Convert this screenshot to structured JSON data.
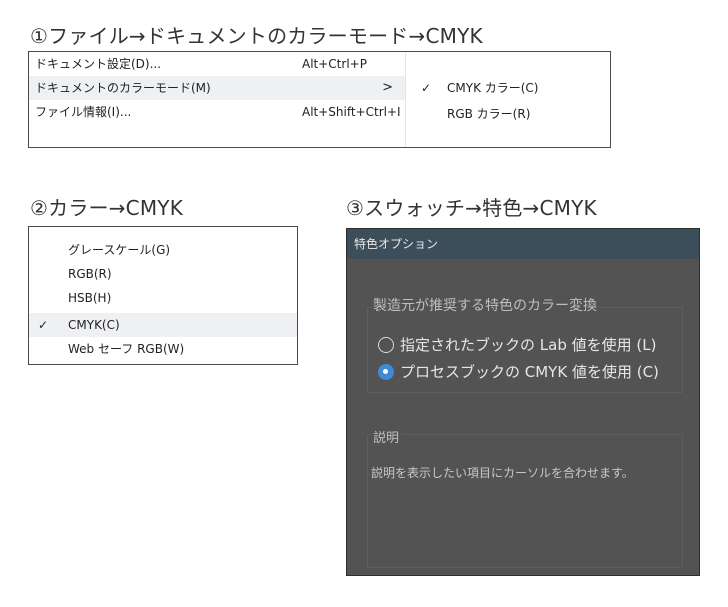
{
  "headings": {
    "section1": "①ファイル→ドキュメントのカラーモード→CMYK",
    "section2": "②カラー→CMYK",
    "section3": "③スウォッチ→特色→CMYK"
  },
  "file_menu": {
    "items": [
      {
        "label": "ドキュメント設定(D)...",
        "shortcut": "Alt+Ctrl+P"
      },
      {
        "label": "ドキュメントのカラーモード(M)",
        "arrow": ">"
      },
      {
        "label": "ファイル情報(I)...",
        "shortcut": "Alt+Shift+Ctrl+I"
      }
    ],
    "submenu": [
      {
        "check": "✓",
        "label": "CMYK カラー(C)"
      },
      {
        "check": "",
        "label": "RGB カラー(R)"
      }
    ]
  },
  "color_menu": {
    "items": [
      {
        "check": "",
        "label": "グレースケール(G)"
      },
      {
        "check": "",
        "label": "RGB(R)"
      },
      {
        "check": "",
        "label": "HSB(H)"
      },
      {
        "check": "✓",
        "label": "CMYK(C)"
      },
      {
        "check": "",
        "label": "Web セーフ RGB(W)"
      }
    ]
  },
  "spot_dialog": {
    "title": "特色オプション",
    "conversion_group": "製造元が推奨する特色のカラー変換",
    "option_lab": "指定されたブックの Lab 値を使用 (L)",
    "option_cmyk": "プロセスブックの CMYK 値を使用 (C)",
    "selected_option": "option_cmyk",
    "description_group": "説明",
    "description_text": "説明を表示したい項目にカーソルを合わせます。"
  },
  "colors": {
    "dialog_bg": "#535353",
    "dialog_title_bg": "#3d4e5b",
    "radio_selected": "#3f8ad7",
    "menu_highlight": "#eef0f3"
  }
}
